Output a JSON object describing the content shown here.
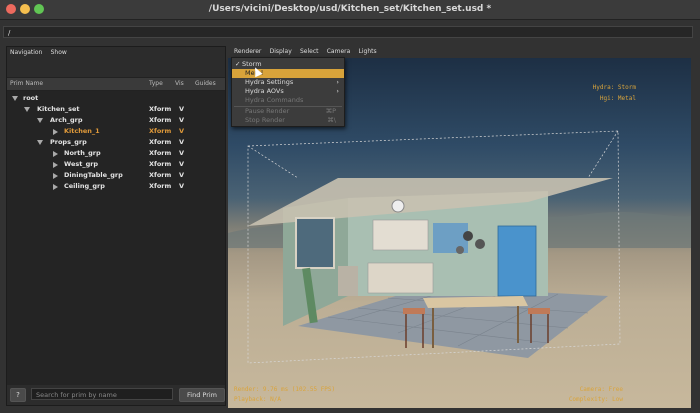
{
  "window": {
    "title": "/Users/vicini/Desktop/usd/Kitchen_set/Kitchen_set.usd *"
  },
  "path_field": {
    "value": "/"
  },
  "left_menu": [
    "Navigation",
    "Show"
  ],
  "tree_header": {
    "prim_name": "Prim Name",
    "type": "Type",
    "vis": "Vis",
    "guides": "Guides"
  },
  "tree_rows": [
    {
      "name": "root",
      "type": "",
      "vis": ""
    },
    {
      "name": "Kitchen_set",
      "type": "Xform",
      "vis": "V"
    },
    {
      "name": "Arch_grp",
      "type": "Xform",
      "vis": "V"
    },
    {
      "name": "Kitchen_1",
      "type": "Xform",
      "vis": "V"
    },
    {
      "name": "Props_grp",
      "type": "Xform",
      "vis": "V"
    },
    {
      "name": "North_grp",
      "type": "Xform",
      "vis": "V"
    },
    {
      "name": "West_grp",
      "type": "Xform",
      "vis": "V"
    },
    {
      "name": "DiningTable_grp",
      "type": "Xform",
      "vis": "V"
    },
    {
      "name": "Ceiling_grp",
      "type": "Xform",
      "vis": "V"
    }
  ],
  "bottom": {
    "help_label": "?",
    "search_placeholder": "Search for prim by name",
    "find_label": "Find Prim"
  },
  "viewport_menu": [
    "Renderer",
    "Display",
    "Select",
    "Camera",
    "Lights"
  ],
  "renderer_menu": {
    "items": [
      {
        "label": "Storm",
        "checked": "✓"
      },
      {
        "label": "Metal"
      },
      {
        "label": "Hydra Settings"
      },
      {
        "label": "Hydra AOVs"
      },
      {
        "label": "Hydra Commands"
      },
      {
        "label": "Pause Render",
        "shortcut": "⌘P"
      },
      {
        "label": "Stop Render",
        "shortcut": "⌘\\"
      }
    ]
  },
  "hud": {
    "hydra": "Hydra: Storm",
    "hgi": "Hgi: Metal",
    "render": "Render: 9.76 ms (102.55 FPS)",
    "playback": "Playback: N/A",
    "camera": "Camera: Free",
    "complexity": "Complexity: Low"
  },
  "colors": {
    "selected_prim": "#e09a3a",
    "menu_highlight": "#d8a33a",
    "hud_text": "#d9a43c"
  }
}
